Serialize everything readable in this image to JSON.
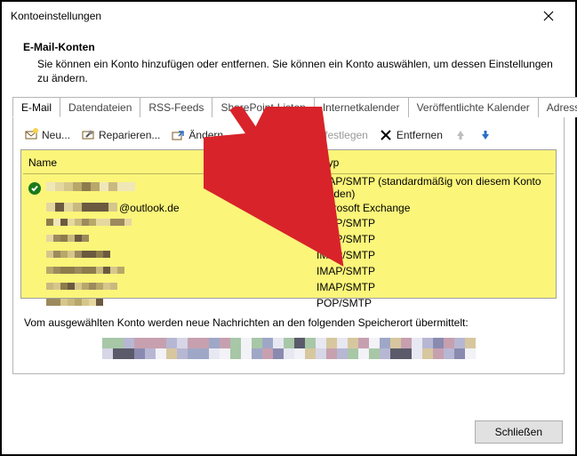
{
  "window": {
    "title": "Kontoeinstellungen",
    "close_btn_glyph": "✕"
  },
  "header": {
    "heading": "E-Mail-Konten",
    "description": "Sie können ein Konto hinzufügen oder entfernen. Sie können ein Konto auswählen, um dessen Einstellungen zu ändern."
  },
  "tabs": {
    "email": "E-Mail",
    "data_files": "Datendateien",
    "rss": "RSS-Feeds",
    "sharepoint": "SharePoint-Listen",
    "internet_cal": "Internetkalender",
    "published_cal": "Veröffentlichte Kalender",
    "address_books": "Adressbücher"
  },
  "toolbar": {
    "new": "Neu...",
    "repair": "Reparieren...",
    "change": "Ändern...",
    "set_default": "Als Standard festlegen",
    "remove": "Entfernen"
  },
  "list": {
    "col_name": "Name",
    "col_type": "Typ",
    "rows": [
      {
        "name_visible": "",
        "type": "IMAP/SMTP (standardmäßig von diesem Konto senden)",
        "default": true
      },
      {
        "name_visible": "@outlook.de",
        "type": "Microsoft Exchange"
      },
      {
        "name_visible": "",
        "type": "IMAP/SMTP"
      },
      {
        "name_visible": "",
        "type": "IMAP/SMTP"
      },
      {
        "name_visible": "",
        "type": "IMAP/SMTP"
      },
      {
        "name_visible": "",
        "type": "IMAP/SMTP"
      },
      {
        "name_visible": "",
        "type": "IMAP/SMTP"
      },
      {
        "name_visible": "",
        "type": "POP/SMTP"
      }
    ]
  },
  "below": {
    "text": "Vom ausgewählten Konto werden neue Nachrichten an den folgenden Speicherort übermittelt:"
  },
  "buttons": {
    "close": "Schließen"
  }
}
